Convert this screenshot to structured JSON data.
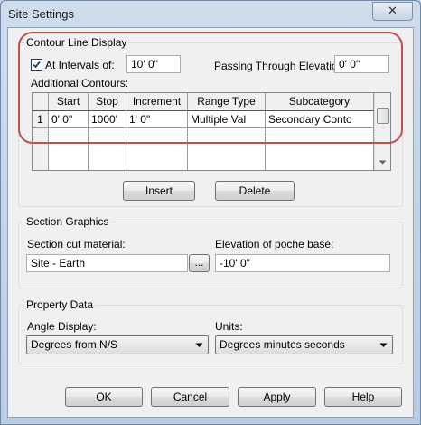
{
  "window": {
    "title": "Site Settings",
    "close_label": "✕"
  },
  "contour": {
    "group_title": "Contour Line Display",
    "at_intervals": {
      "label": "At Intervals of:",
      "checked": true,
      "value": "10'  0\""
    },
    "passing": {
      "label": "Passing Through Elevation:",
      "value": "0'  0\""
    },
    "additional_label": "Additional Contours:",
    "columns": [
      "Start",
      "Stop",
      "Increment",
      "Range Type",
      "Subcategory"
    ],
    "rows": [
      {
        "num": "1",
        "start": "0'  0\"",
        "stop": "1000'",
        "increment": "1'  0\"",
        "range_type": "Multiple Val",
        "subcategory": "Secondary Conto"
      }
    ],
    "insert_label": "Insert",
    "delete_label": "Delete"
  },
  "section": {
    "group_title": "Section Graphics",
    "material_label": "Section cut material:",
    "material_value": "Site - Earth",
    "browse_label": "...",
    "poche_label": "Elevation of poche base:",
    "poche_value": "-10'  0\""
  },
  "property": {
    "group_title": "Property Data",
    "angle_label": "Angle Display:",
    "angle_value": "Degrees from N/S",
    "units_label": "Units:",
    "units_value": "Degrees minutes seconds"
  },
  "buttons": {
    "ok": "OK",
    "cancel": "Cancel",
    "apply": "Apply",
    "help": "Help"
  },
  "colors": {
    "highlight": "#c0504d",
    "title_bar": "#c4d3e6"
  }
}
